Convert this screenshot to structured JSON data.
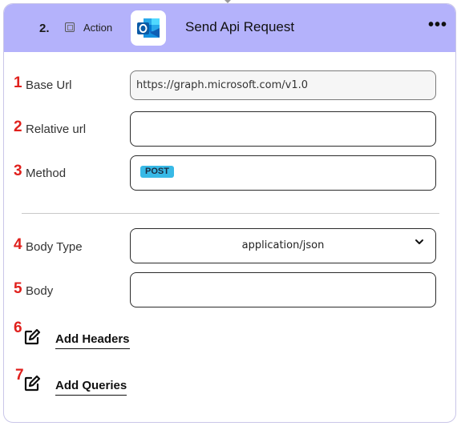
{
  "header": {
    "step_number": "2.",
    "action_label": "Action",
    "app_icon": "outlook-icon",
    "title": "Send Api Request",
    "more_icon": "more-horizontal-icon",
    "more_label": "•••",
    "background_color": "#b4b2fb"
  },
  "fields": {
    "base_url": {
      "number": "1",
      "label": "Base Url",
      "value": "https://graph.microsoft.com/v1.0"
    },
    "relative_url": {
      "number": "2",
      "label": "Relative url",
      "value": ""
    },
    "method": {
      "number": "3",
      "label": "Method",
      "value": "POST"
    },
    "body_type": {
      "number": "4",
      "label": "Body Type",
      "value": "application/json"
    },
    "body": {
      "number": "5",
      "label": "Body",
      "value": ""
    }
  },
  "links": {
    "add_headers": {
      "number": "6",
      "label": "Add Headers",
      "icon": "edit-icon"
    },
    "add_queries": {
      "number": "7",
      "label": "Add Queries",
      "icon": "edit-icon"
    }
  },
  "colors": {
    "step_number_red": "#e0201c",
    "method_badge": "#38b9e6"
  }
}
